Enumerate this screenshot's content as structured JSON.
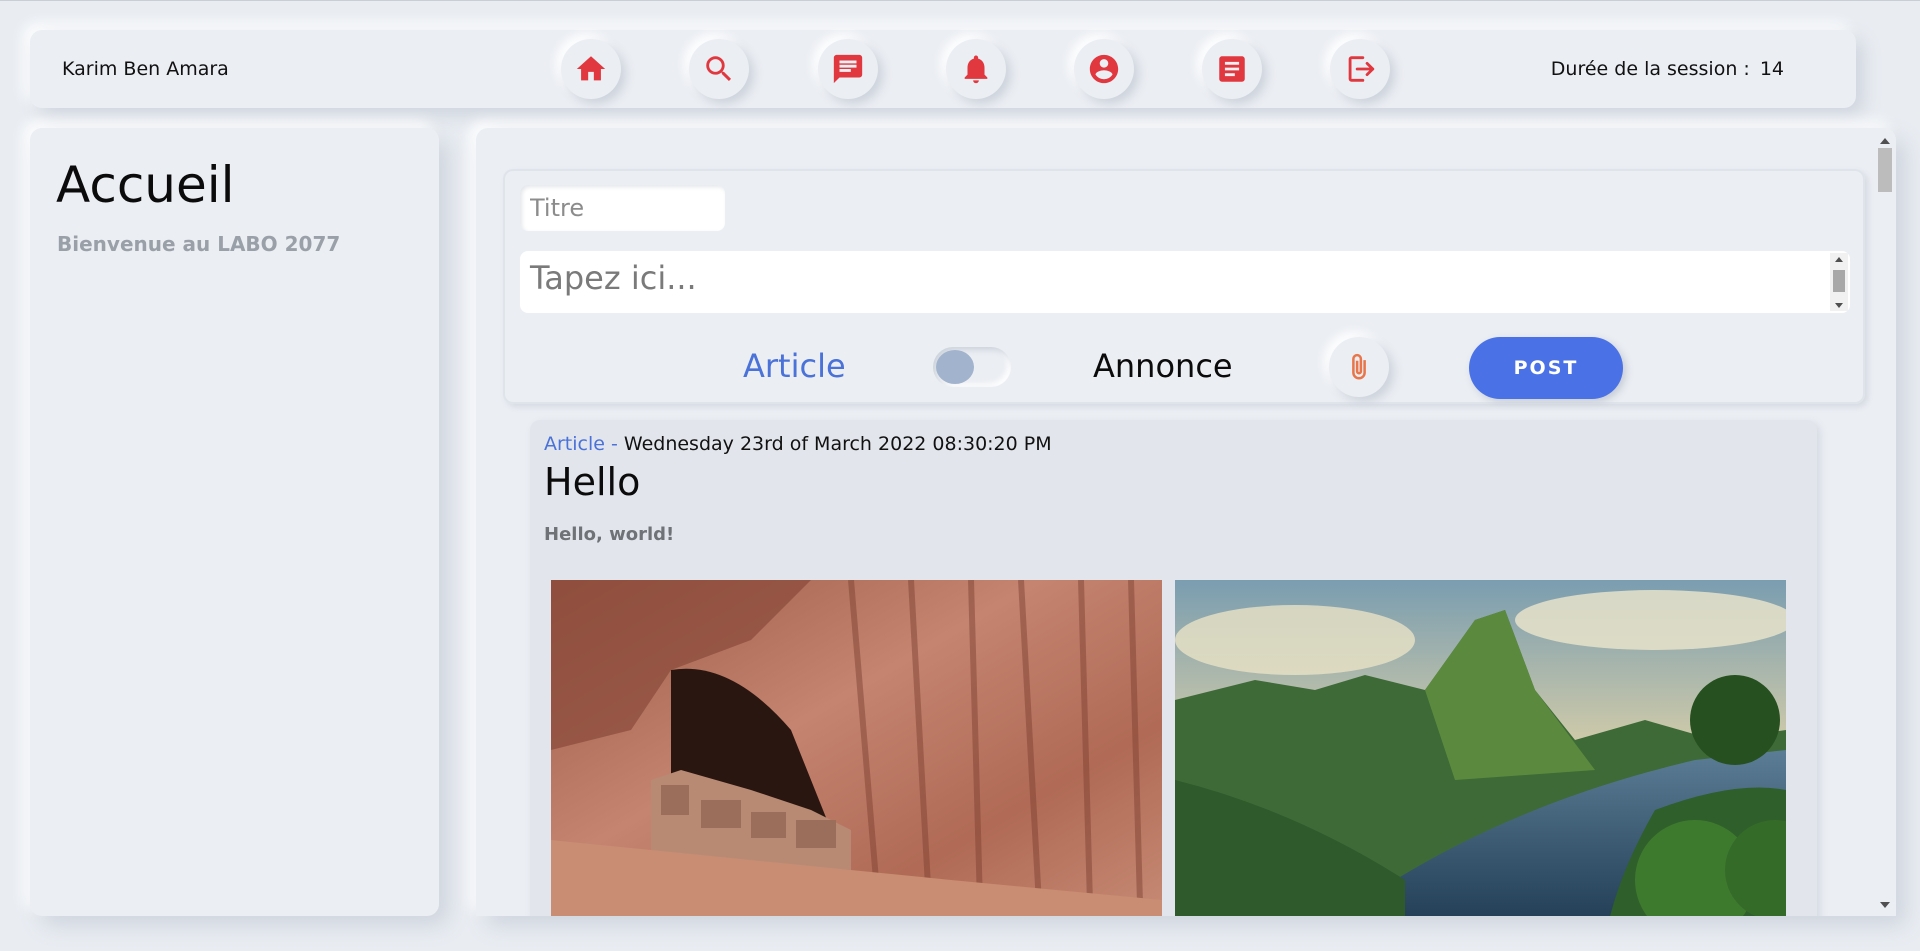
{
  "header": {
    "user_name": "Karim Ben Amara",
    "session_label": "Durée de la session :",
    "session_value": "14",
    "nav_icons": [
      "home-icon",
      "search-icon",
      "messages-icon",
      "notifications-icon",
      "profile-icon",
      "document-icon",
      "logout-icon"
    ],
    "accent_color": "#e0383e"
  },
  "sidebar": {
    "title": "Accueil",
    "subtitle": "Bienvenue au LABO 2077"
  },
  "composer": {
    "title_placeholder": "Titre",
    "body_placeholder": "Tapez ici...",
    "label_article": "Article",
    "label_annonce": "Annonce",
    "post_label": "POST",
    "toggle_state": "article",
    "attach_icon": "paperclip-icon",
    "post_button_color": "#4a72e6",
    "article_color": "#4a72d8"
  },
  "post": {
    "type": "Article -",
    "date": "Wednesday 23rd of March 2022 08:30:20 PM",
    "title": "Hello",
    "body": "Hello, world!",
    "images": [
      "canyon-cliff-dwelling-photo",
      "tropical-mountain-bay-photo"
    ]
  }
}
